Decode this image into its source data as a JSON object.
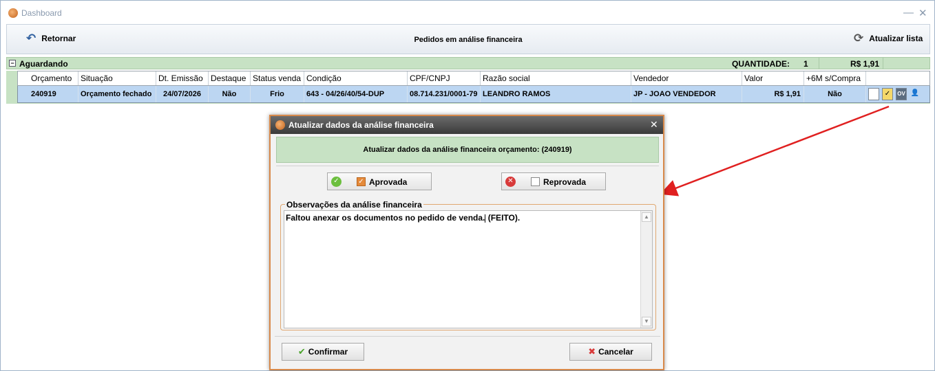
{
  "window": {
    "title": "Dashboard"
  },
  "toolbar": {
    "back_label": "Retornar",
    "title": "Pedidos em análise financeira",
    "refresh_label": "Atualizar lista"
  },
  "group": {
    "label": "Aguardando",
    "qty_label": "QUANTIDADE:",
    "qty_value": "1",
    "total": "R$ 1,91"
  },
  "columns": [
    "Orçamento",
    "Situação",
    "Dt. Emissão",
    "Destaque",
    "Status venda",
    "Condição",
    "CPF/CNPJ",
    "Razão social",
    "Vendedor",
    "Valor",
    "+6M s/Compra"
  ],
  "row": {
    "num": "61",
    "cells": [
      "240919",
      "Orçamento fechado",
      "24/07/2026",
      "Não",
      "Frio",
      "643 - 04/26/40/54-DUP",
      "08.714.231/0001-79",
      "LEANDRO RAMOS",
      "JP - JOAO VENDEDOR",
      "R$ 1,91",
      "Não"
    ],
    "ov_label": "OV"
  },
  "dialog": {
    "title": "Atualizar dados da análise financeira",
    "banner": "Atualizar dados da análise financeira orçamento: (240919)",
    "approve_label": "Aprovada",
    "reject_label": "Reprovada",
    "obs_label": "Observações da análise financeira",
    "obs_text_before": "Faltou anexar os documentos no pedido de venda.",
    "obs_text_after": "(FEITO).",
    "confirm_label": "Confirmar",
    "cancel_label": "Cancelar"
  },
  "colors": {
    "accent": "#d8894a",
    "group_bg": "#c7e2c4",
    "row_selected": "#bcd6f2",
    "arrow": "#e02020"
  }
}
